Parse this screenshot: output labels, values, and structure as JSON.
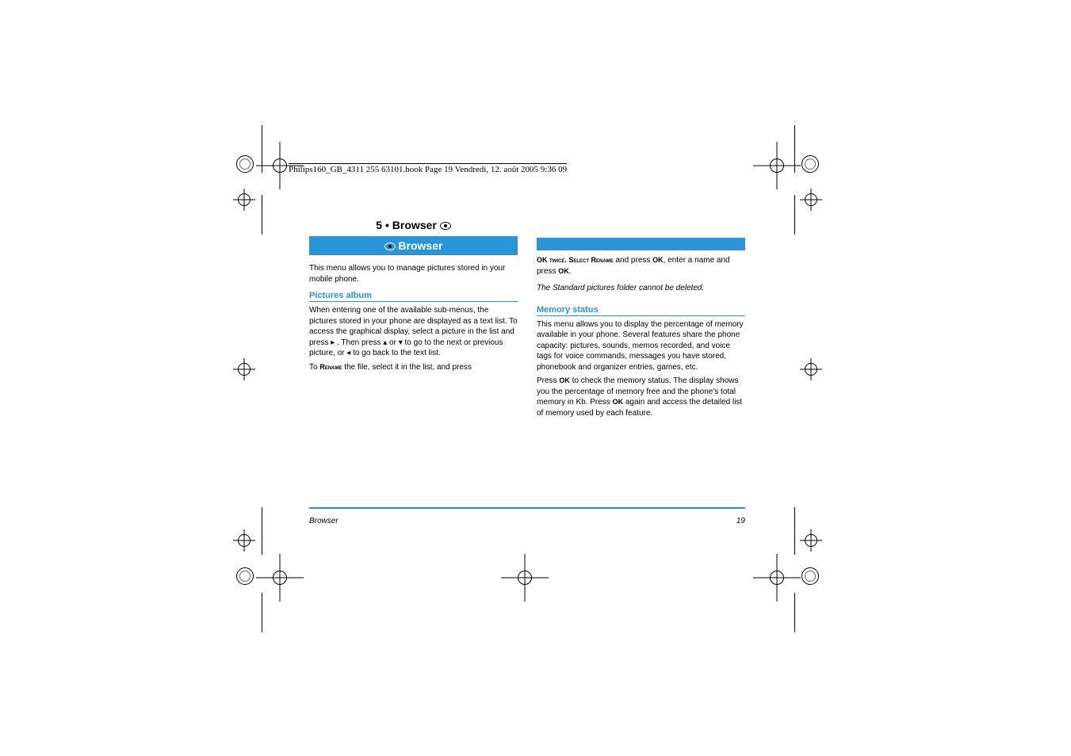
{
  "header": {
    "file_info": "Philips160_GB_4311 255 63101.book  Page 19  Vendredi, 12. août 2005  9:36 09"
  },
  "chapter": {
    "number": "5 • Browser",
    "eye_heading": "Browser",
    "intro": "This menu allows you to manage pictures stored in your mobile phone."
  },
  "pictures_album": {
    "heading": "Pictures album",
    "body_intro": "When entering one of the available sub-menus, the pictures stored in your phone are displayed as a text list. To access the graphical display, select a picture in the list and press ",
    "right_key": "▸",
    "after_right": ". Then press ",
    "up_key": "▴",
    "or_word": " or ",
    "down_key": "▾",
    "after_down": " to go to the next or previous picture, or ",
    "left_key": "◂",
    "to_back": " to go back to the text list.",
    "rename_intro": "To ",
    "rename_word": "Rename",
    "rename_rest": " the file, select it in the list, and press "
  },
  "right_col": {
    "ok_twice": "OK twice. Select ",
    "rename_b": "Rename",
    "and_press": " and press ",
    "ok_word": "OK",
    "enter_name": ", enter a name and press ",
    "ok_word2": "OK",
    "period": ".",
    "note": "The Standard pictures folder cannot be deleted.",
    "mem_heading": "Memory status",
    "mem_body": "This menu allows you to display the percentage of memory available in your phone. Several features share the phone capacity: pictures, sounds, memos recorded, and voice tags for voice commands, messages you have stored, phonebook and organizer entries, games, etc.",
    "mem_press": "Press ",
    "mem_ok": "OK",
    "mem_rest": " to check the memory status. The display shows you the percentage of memory free and the phone's total memory in Kb. Press ",
    "mem_ok2": "OK",
    "mem_again": " again and access the detailed list of memory used by each feature."
  },
  "footer": {
    "section": "Browser",
    "page": "19"
  }
}
